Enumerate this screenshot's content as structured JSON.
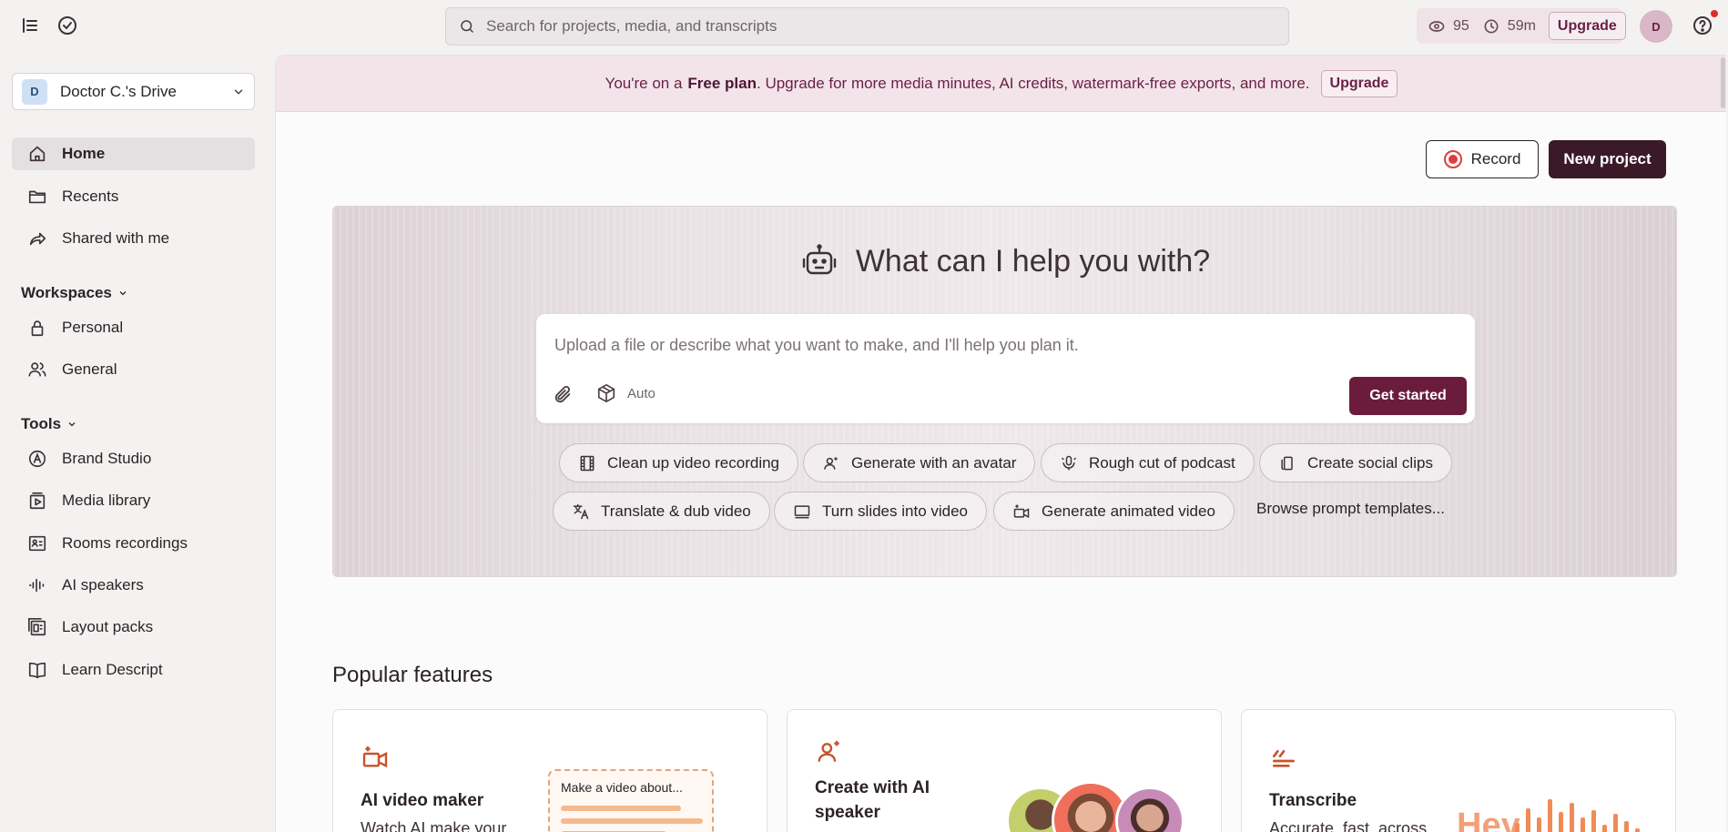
{
  "top": {
    "search_placeholder": "Search for projects, media, and transcripts",
    "credits": "95",
    "minutes": "59m",
    "upgrade": "Upgrade",
    "avatar_initial": "D"
  },
  "sidebar": {
    "drive_initial": "D",
    "drive_name": "Doctor C.'s Drive",
    "nav": [
      {
        "label": "Home",
        "icon": "home-icon"
      },
      {
        "label": "Recents",
        "icon": "folder-icon"
      },
      {
        "label": "Shared with me",
        "icon": "share-icon"
      }
    ],
    "workspaces_heading": "Workspaces",
    "workspaces": [
      {
        "label": "Personal",
        "icon": "lock-icon"
      },
      {
        "label": "General",
        "icon": "users-icon"
      }
    ],
    "tools_heading": "Tools",
    "tools": [
      {
        "label": "Brand Studio",
        "icon": "brand-icon"
      },
      {
        "label": "Media library",
        "icon": "media-icon"
      },
      {
        "label": "Rooms recordings",
        "icon": "rooms-icon"
      },
      {
        "label": "AI speakers",
        "icon": "waveform-icon"
      },
      {
        "label": "Layout packs",
        "icon": "layout-icon"
      },
      {
        "label": "Learn Descript",
        "icon": "book-icon"
      }
    ]
  },
  "banner": {
    "prefix": "You're on a",
    "plan": "Free plan",
    "suffix": ". Upgrade for more media minutes, AI credits, watermark-free exports, and more.",
    "button": "Upgrade"
  },
  "actions": {
    "record": "Record",
    "new_project": "New project"
  },
  "hero": {
    "title": "What can I help you with?",
    "placeholder": "Upload a file or describe what you want to make, and I'll help you plan it.",
    "model": "Auto",
    "submit": "Get started",
    "chips": [
      "Clean up video recording",
      "Generate with an avatar",
      "Rough cut of podcast",
      "Create social clips",
      "Translate & dub video",
      "Turn slides into video",
      "Generate animated video"
    ],
    "browse": "Browse prompt templates..."
  },
  "popular": {
    "heading": "Popular features",
    "cards": [
      {
        "title": "AI video maker",
        "subtitle": "Watch AI make your",
        "preview": "Make a video about..."
      },
      {
        "title": "Create with AI speaker",
        "subtitle": ""
      },
      {
        "title": "Transcribe",
        "subtitle": "Accurate, fast, across",
        "preview": "Hey"
      }
    ]
  },
  "colors": {
    "accent": "#6b1c3d",
    "dark": "#3b1a27",
    "banner": "#f3e4ea",
    "record": "#e03c3c"
  }
}
